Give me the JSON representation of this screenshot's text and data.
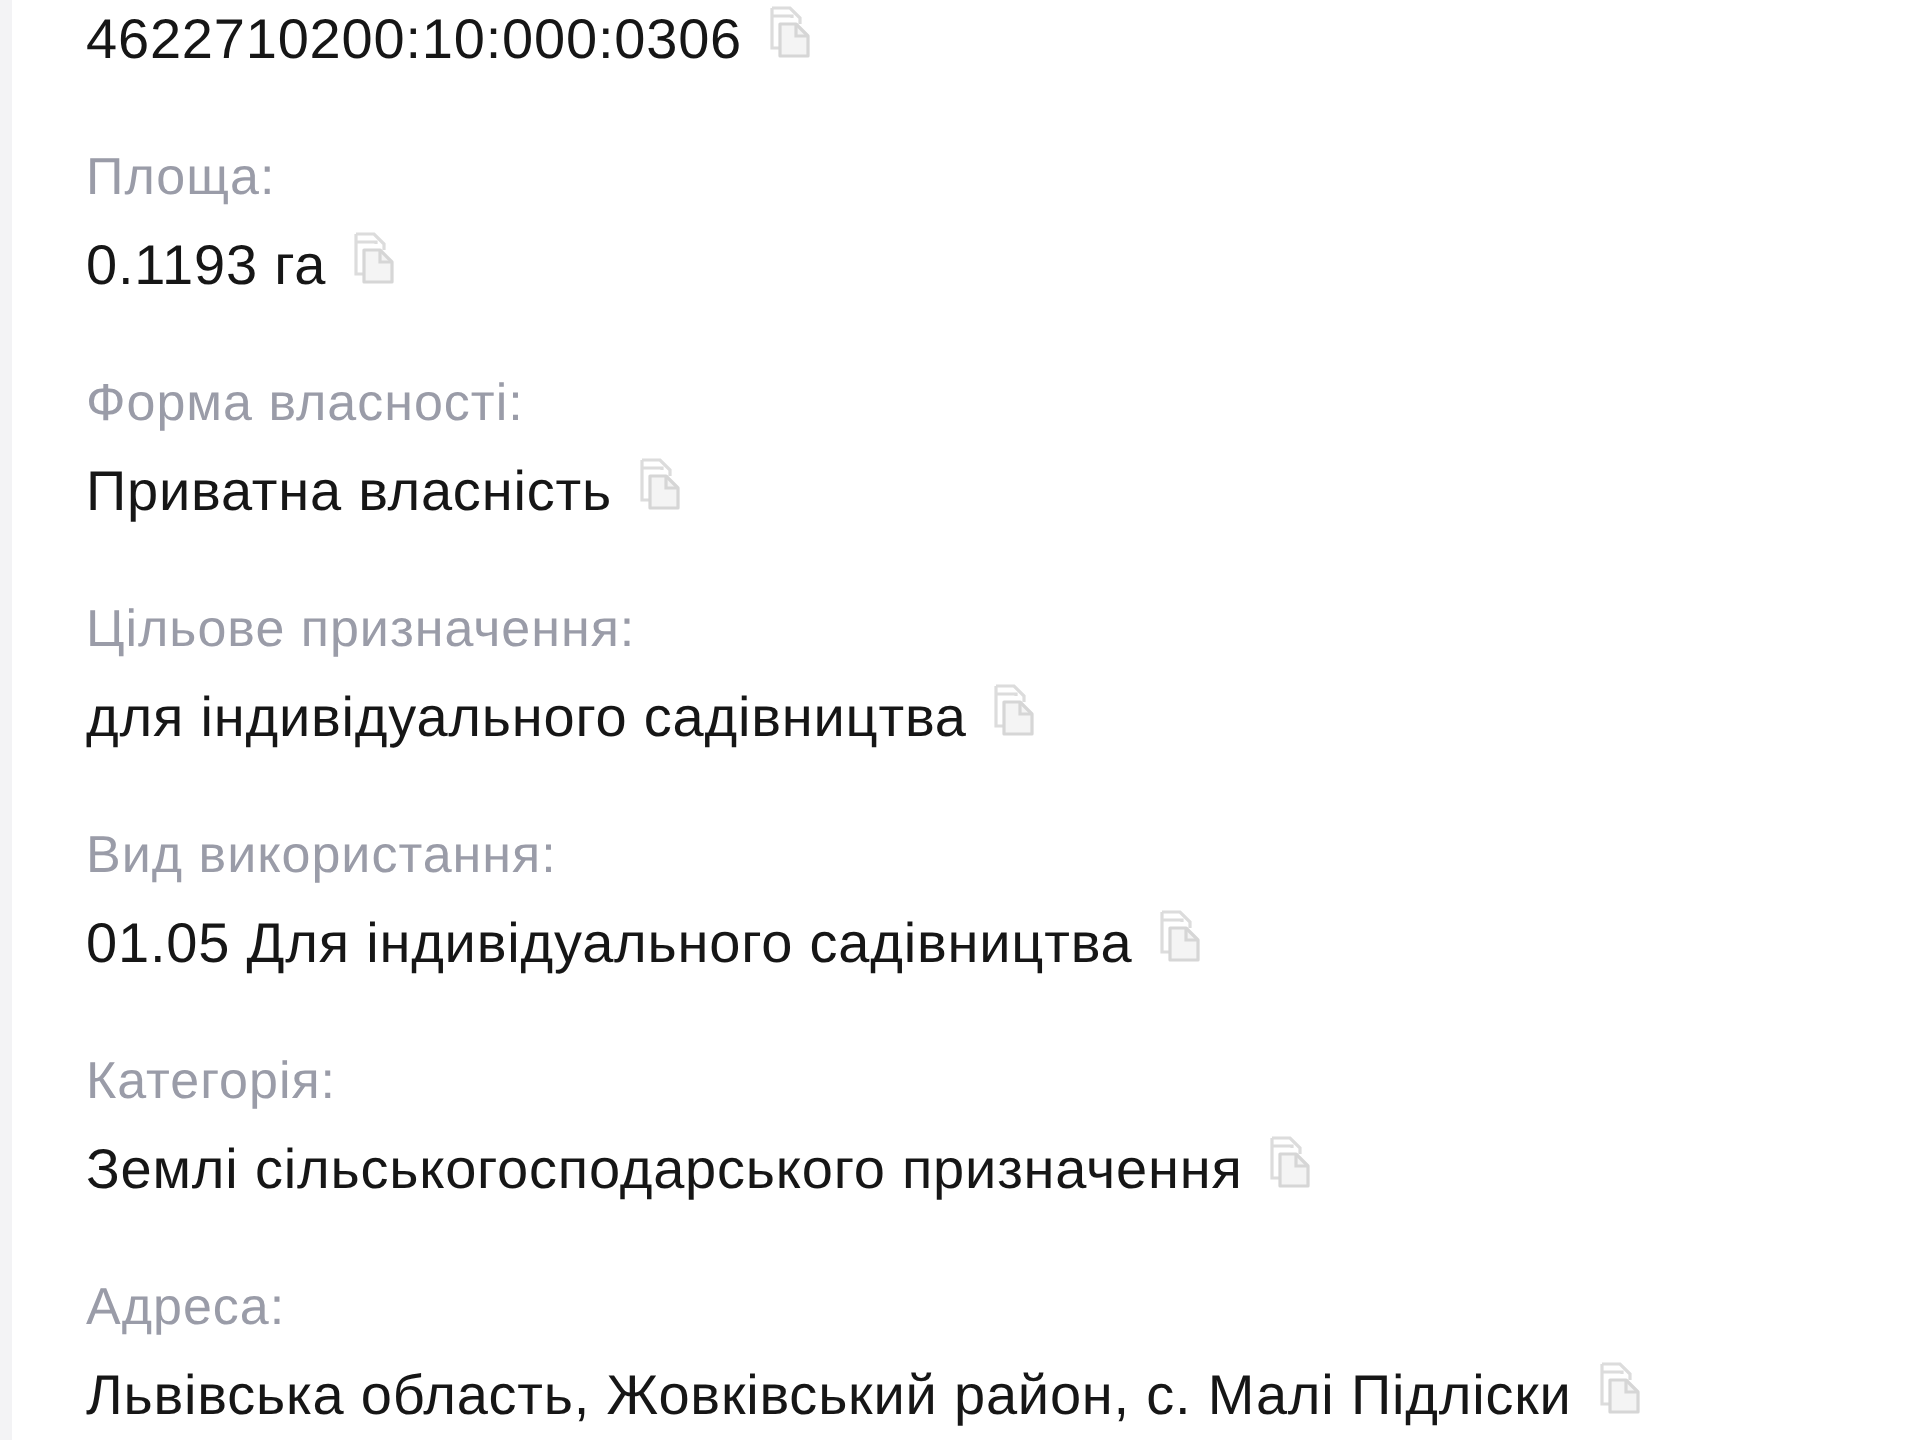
{
  "fields": [
    {
      "value": "4622710200:10:000:0306"
    },
    {
      "label": "Площа:",
      "value": "0.1193 га"
    },
    {
      "label": "Форма власності:",
      "value": "Приватна власність"
    },
    {
      "label": "Цільове призначення:",
      "value": "для індивідуального садівництва"
    },
    {
      "label": "Вид використання:",
      "value": "01.05 Для індивідуального садівництва"
    },
    {
      "label": "Категорія:",
      "value": "Землі сільськогосподарського призначення"
    },
    {
      "label": "Адреса:",
      "value": "Львівська область, Жовківський район, с. Малі Підліски"
    }
  ]
}
